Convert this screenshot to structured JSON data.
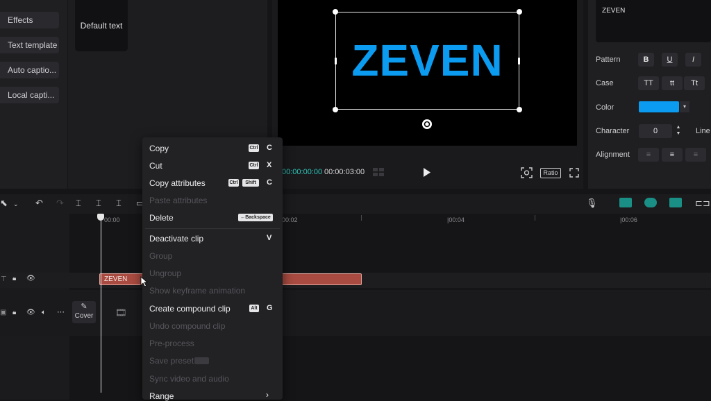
{
  "left_menu": {
    "items": [
      {
        "label": "Effects"
      },
      {
        "label": "Text template"
      },
      {
        "label": "Auto captio..."
      },
      {
        "label": "Local capti..."
      }
    ]
  },
  "asset_panel": {
    "card_label": "Default text"
  },
  "preview": {
    "canvas_text": "ZEVEN",
    "current_time": "00:00:00:00",
    "total_time": "00:00:03:00",
    "ratio_label": "Ratio"
  },
  "properties": {
    "text_value": "ZEVEN",
    "pattern_label": "Pattern",
    "pattern_buttons": [
      "B",
      "U",
      "I"
    ],
    "case_label": "Case",
    "case_buttons": [
      "TT",
      "tt",
      "Tt"
    ],
    "color_label": "Color",
    "color_value": "#0b9bf0",
    "character_label": "Character",
    "character_value": "0",
    "line_label": "Line",
    "alignment_label": "Alignment"
  },
  "timeline": {
    "ruler": [
      "00:00",
      "00:02",
      "|00:04",
      "|00:06"
    ],
    "clip_label": "ZEVEN",
    "cover_label": "Cover"
  },
  "context_menu": {
    "items": [
      {
        "label": "Copy",
        "keys": [
          "Ctrl"
        ],
        "key": "C",
        "enabled": true
      },
      {
        "label": "Cut",
        "keys": [
          "Ctrl"
        ],
        "key": "X",
        "enabled": true
      },
      {
        "label": "Copy attributes",
        "keys": [
          "Ctrl",
          "Shift"
        ],
        "key": "C",
        "enabled": true
      },
      {
        "label": "Paste attributes",
        "enabled": false
      },
      {
        "label": "Delete",
        "keys": [
          "←Backspace"
        ],
        "enabled": true
      },
      {
        "label": "Deactivate clip",
        "key": "V",
        "enabled": true
      },
      {
        "label": "Group",
        "enabled": false
      },
      {
        "label": "Ungroup",
        "enabled": false
      },
      {
        "label": "Show keyframe animation",
        "enabled": false
      },
      {
        "label": "Create compound clip",
        "keys": [
          "Alt"
        ],
        "key": "G",
        "enabled": true
      },
      {
        "label": "Undo compound clip",
        "enabled": false
      },
      {
        "label": "Pre-process",
        "enabled": false
      },
      {
        "label": "Save preset",
        "enabled": false
      },
      {
        "label": "Sync video and audio",
        "enabled": false
      },
      {
        "label": "Range",
        "enabled": true
      }
    ]
  },
  "colors": {
    "accent": "#0b9bf0",
    "clip": "#a94b40",
    "timecode": "#2ec4b6"
  }
}
